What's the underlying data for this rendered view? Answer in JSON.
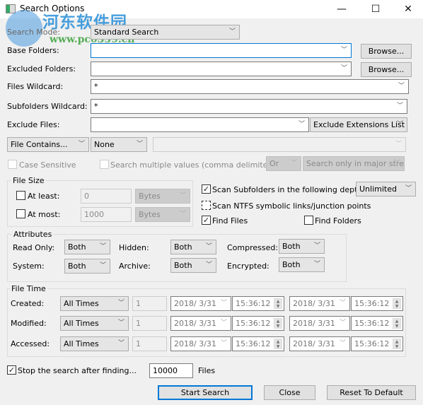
{
  "window": {
    "title": "Search Options",
    "minimize": "—",
    "maximize": "☐",
    "close": "✕"
  },
  "watermark": {
    "line1": "河东软件园",
    "line2": "www.pc0359.cn"
  },
  "fields": {
    "search_mode": {
      "label": "Search Mode:",
      "value": "Standard Search"
    },
    "base_folders": {
      "label": "Base Folders:",
      "value": "",
      "browse": "Browse..."
    },
    "excluded_folders": {
      "label": "Excluded Folders:",
      "value": "",
      "browse": "Browse..."
    },
    "files_wildcard": {
      "label": "Files Wildcard:",
      "value": "*"
    },
    "subfolders_wildcard": {
      "label": "Subfolders Wildcard:",
      "value": "*"
    },
    "exclude_files": {
      "label": "Exclude Files:",
      "value": "",
      "mode": "Exclude Extensions List"
    }
  },
  "contains": {
    "type": "File Contains...",
    "format": "None",
    "value": "",
    "case_sensitive": {
      "label": "Case Sensitive",
      "checked": false
    },
    "multiple_values": {
      "label": "Search multiple values (comma delimited)",
      "checked": false
    },
    "logic": "Or",
    "stream": "Search only in major stre:"
  },
  "file_size": {
    "title": "File Size",
    "at_least": {
      "label": "At least:",
      "value": "0",
      "unit": "Bytes",
      "checked": false
    },
    "at_most": {
      "label": "At most:",
      "value": "1000",
      "unit": "Bytes",
      "checked": false
    }
  },
  "scan": {
    "subfolders": {
      "label": "Scan Subfolders in the following depth:",
      "checked": true,
      "depth": "Unlimited"
    },
    "ntfs": {
      "label": "Scan NTFS symbolic links/junction points",
      "checked": false
    },
    "find_files": {
      "label": "Find Files",
      "checked": true
    },
    "find_folders": {
      "label": "Find Folders",
      "checked": false
    }
  },
  "attributes": {
    "title": "Attributes",
    "items": [
      {
        "label": "Read Only:",
        "value": "Both"
      },
      {
        "label": "Hidden:",
        "value": "Both"
      },
      {
        "label": "Compressed:",
        "value": "Both"
      },
      {
        "label": "System:",
        "value": "Both"
      },
      {
        "label": "Archive:",
        "value": "Both"
      },
      {
        "label": "Encrypted:",
        "value": "Both"
      }
    ]
  },
  "file_time": {
    "title": "File Time",
    "rows": [
      {
        "label": "Created:",
        "mode": "All Times",
        "count": "1",
        "from_date": "2018/  3/31",
        "from_time": "15:36:12",
        "to_date": "2018/  3/31",
        "to_time": "15:36:12"
      },
      {
        "label": "Modified:",
        "mode": "All Times",
        "count": "1",
        "from_date": "2018/  3/31",
        "from_time": "15:36:12",
        "to_date": "2018/  3/31",
        "to_time": "15:36:12"
      },
      {
        "label": "Accessed:",
        "mode": "All Times",
        "count": "1",
        "from_date": "2018/  3/31",
        "from_time": "15:36:12",
        "to_date": "2018/  3/31",
        "to_time": "15:36:12"
      }
    ]
  },
  "stop_after": {
    "label": "Stop the search after finding...",
    "checked": true,
    "value": "10000",
    "unit": "Files"
  },
  "buttons": {
    "start": "Start Search",
    "close": "Close",
    "reset": "Reset To Default"
  },
  "icons": {
    "check": "✓",
    "dropdown": "﹀",
    "spin_up": "▲",
    "spin_down": "▼"
  }
}
